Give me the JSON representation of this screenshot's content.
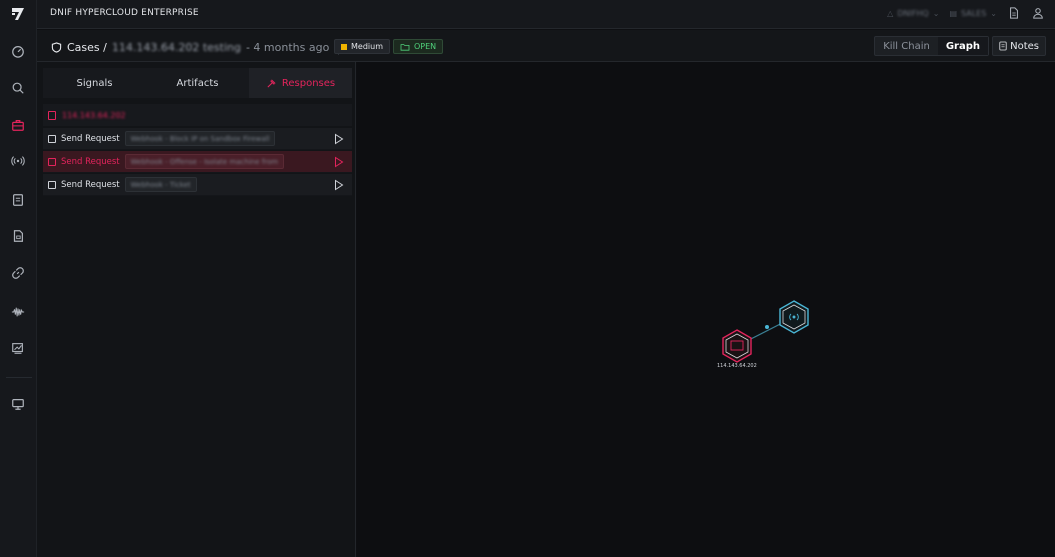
{
  "app": {
    "title": "DNIF HYPERCLOUD ENTERPRISE"
  },
  "topbar": {
    "org": "DNIFHQ",
    "workspace": "SALES"
  },
  "case": {
    "crumb_root": "Cases /",
    "name": "114.143.64.202 testing",
    "age": "- 4 months ago",
    "severity": "Medium",
    "status": "OPEN"
  },
  "view_toggle": {
    "kill_chain": "Kill Chain",
    "graph": "Graph",
    "active": "Graph"
  },
  "notes_label": "Notes",
  "tabs": [
    {
      "label": "Signals",
      "active": false
    },
    {
      "label": "Artifacts",
      "active": false
    },
    {
      "label": "Responses",
      "active": true
    }
  ],
  "responses": {
    "group_label": "114.143.64.202",
    "rows": [
      {
        "label": "Send Request",
        "webhook": "Webhook - Block IP on Sandbox Firewall",
        "selected": false
      },
      {
        "label": "Send Request",
        "webhook": "Webhook - Offense - Isolate machine from",
        "selected": true
      },
      {
        "label": "Send Request",
        "webhook": "Webhook - Ticket",
        "selected": false
      }
    ]
  },
  "graph": {
    "source_node_label": "114.143.64.202"
  },
  "colors": {
    "accent": "#e3245c",
    "medium": "#f0b400",
    "open": "#4fd07a",
    "node_signal": "#4ab6d6"
  }
}
